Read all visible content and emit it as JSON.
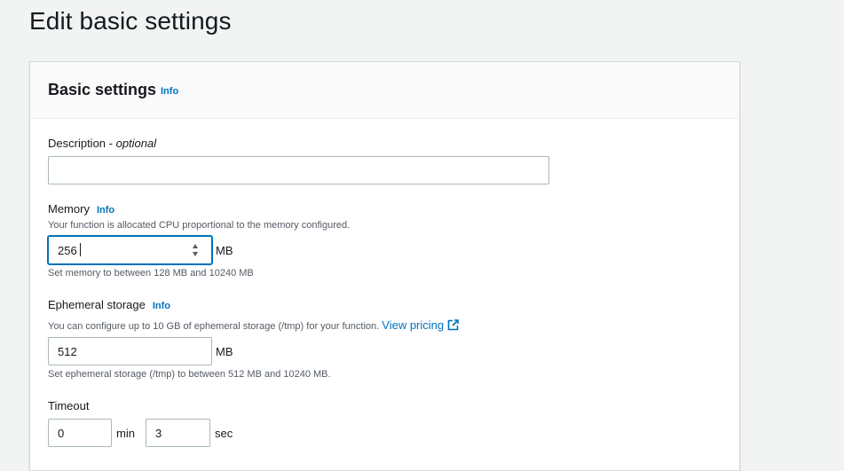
{
  "page": {
    "title": "Edit basic settings"
  },
  "panel": {
    "title": "Basic settings",
    "info": "Info"
  },
  "description": {
    "label": "Description",
    "label_sep": " - ",
    "label_optional": "optional",
    "value": "",
    "placeholder": ""
  },
  "memory": {
    "label": "Memory",
    "info": "Info",
    "description": "Your function is allocated CPU proportional to the memory configured.",
    "value": "256",
    "unit": "MB",
    "constraint": "Set memory to between 128 MB and 10240 MB"
  },
  "ephemeral_storage": {
    "label": "Ephemeral storage",
    "info": "Info",
    "description": "You can configure up to 10 GB of ephemeral storage (/tmp) for your function.",
    "pricing_link": "View pricing",
    "value": "512",
    "unit": "MB",
    "constraint": "Set ephemeral storage (/tmp) to between 512 MB and 10240 MB."
  },
  "timeout": {
    "label": "Timeout",
    "min_value": "0",
    "min_unit": "min",
    "sec_value": "3",
    "sec_unit": "sec"
  },
  "colors": {
    "link": "#0073bb",
    "focus": "#0073bb",
    "border": "#aab7b8",
    "background": "#f2f3f3"
  }
}
